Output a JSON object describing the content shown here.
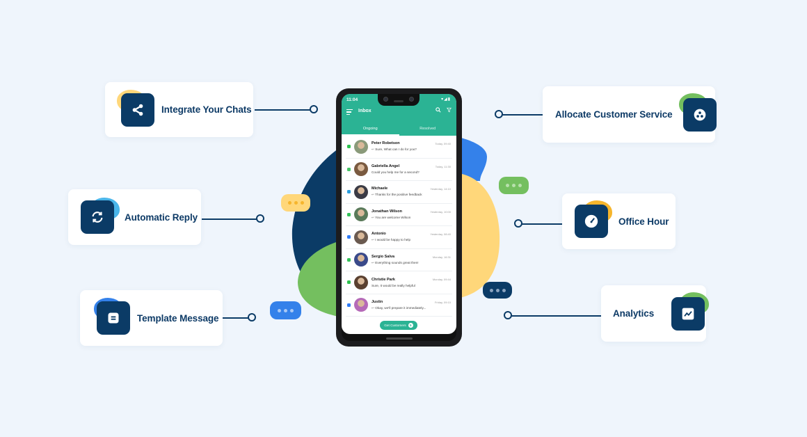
{
  "colors": {
    "background": "#eff5fc",
    "navy": "#0b3b66",
    "teal": "#2bb394",
    "yellow": "#ffd77a",
    "green": "#74bf5f",
    "blue": "#3481ea",
    "light_blue": "#4bb6ea",
    "orange": "#f6b52c"
  },
  "features": {
    "left": [
      {
        "label": "Integrate Your Chats",
        "icon": "share-icon",
        "accent": "yellow"
      },
      {
        "label": "Automatic Reply",
        "icon": "refresh-icon",
        "accent": "light_blue"
      },
      {
        "label": "Template Message",
        "icon": "template-icon",
        "accent": "blue"
      }
    ],
    "right": [
      {
        "label": "Allocate Customer Service",
        "icon": "group-icon",
        "accent": "green"
      },
      {
        "label": "Office Hour",
        "icon": "clock-icon",
        "accent": "orange"
      },
      {
        "label": "Analytics",
        "icon": "chart-icon",
        "accent": "green"
      }
    ]
  },
  "phone": {
    "status_time": "11:04",
    "status_icons": "▾◢▮",
    "header_title": "Inbox",
    "tabs": [
      {
        "label": "Ongoing",
        "active": true
      },
      {
        "label": "Resolved",
        "active": false
      }
    ],
    "chats": [
      {
        "name": "Peter Robetson",
        "message": "Sure, What can I do for you?",
        "time": "Today, 09:40",
        "channel": "line",
        "replied": true
      },
      {
        "name": "Gabriella Angel",
        "message": "Could you help me for a second?",
        "time": "Today, 11:30",
        "channel": "wechat",
        "replied": false
      },
      {
        "name": "Michaele",
        "message": "Thanks for the positive feedback",
        "time": "Yesterday, 14:10",
        "channel": "telegram",
        "replied": true
      },
      {
        "name": "Jonathan Wilson",
        "message": "You are welcome Wilson",
        "time": "Yesterday, 10:00",
        "channel": "whatsapp",
        "replied": true
      },
      {
        "name": "Antonio",
        "message": "I would be happy to help",
        "time": "Yesterday, 08:40",
        "channel": "messenger",
        "replied": true
      },
      {
        "name": "Sergio Salva",
        "message": "Everything sounds great then!",
        "time": "Monday, 16:31",
        "channel": "whatsapp",
        "replied": true
      },
      {
        "name": "Christie Park",
        "message": "Sure, It would be really helpful",
        "time": "Monday, 09:44",
        "channel": "line",
        "replied": false
      },
      {
        "name": "Justin",
        "message": "Okay, we'll prepare it immediately...",
        "time": "Friday, 09:10",
        "channel": "messenger",
        "replied": true
      }
    ],
    "cta_label": "Get Customers",
    "cta_count": "5"
  }
}
